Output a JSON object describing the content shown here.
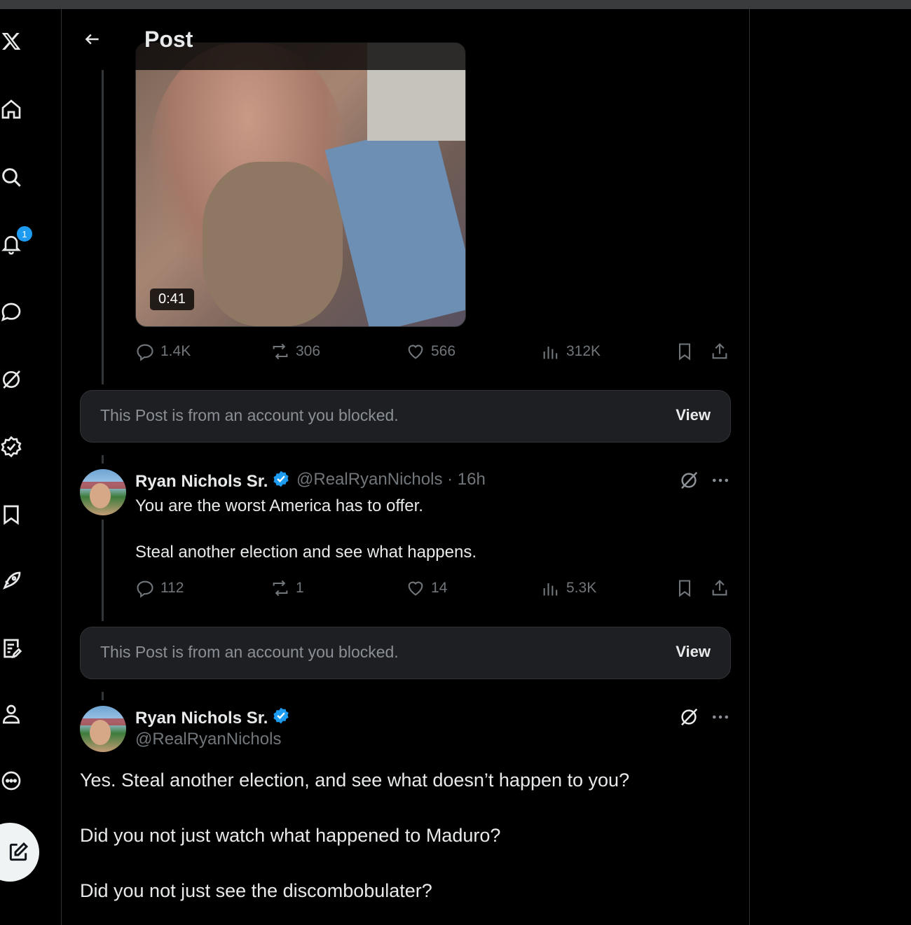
{
  "header": {
    "title": "Post"
  },
  "nav": {
    "items": [
      "x-logo",
      "home",
      "explore",
      "notifications",
      "messages",
      "grok",
      "verified",
      "bookmarks",
      "premium",
      "lists",
      "profile",
      "more"
    ],
    "notification_count": "1"
  },
  "video": {
    "duration": "0:41"
  },
  "post1": {
    "replies": "1.4K",
    "reposts": "306",
    "likes": "566",
    "views": "312K"
  },
  "blocked_notice": {
    "text": "This Post is from an account you blocked.",
    "view_label": "View"
  },
  "reply1": {
    "name": "Ryan Nichols Sr.",
    "handle_time": "@RealRyanNichols · 16h",
    "line1": "You are the worst America has to offer.",
    "line2": "Steal another election and see what happens.",
    "replies": "112",
    "reposts": "1",
    "likes": "14",
    "views": "5.3K"
  },
  "blocked_notice2": {
    "text": "This Post is from an account you blocked.",
    "view_label": "View"
  },
  "main_post": {
    "name": "Ryan Nichols Sr.",
    "handle": "@RealRyanNichols",
    "line1": "Yes. Steal another election, and see what doesn’t happen to you?",
    "line2": "Did you not just watch what happened to Maduro?",
    "line3": "Did you not just see the discombobulater?"
  },
  "colors": {
    "accent": "#1d9bf0",
    "background": "#000000",
    "muted": "#71767b",
    "card": "#1d1f23"
  }
}
